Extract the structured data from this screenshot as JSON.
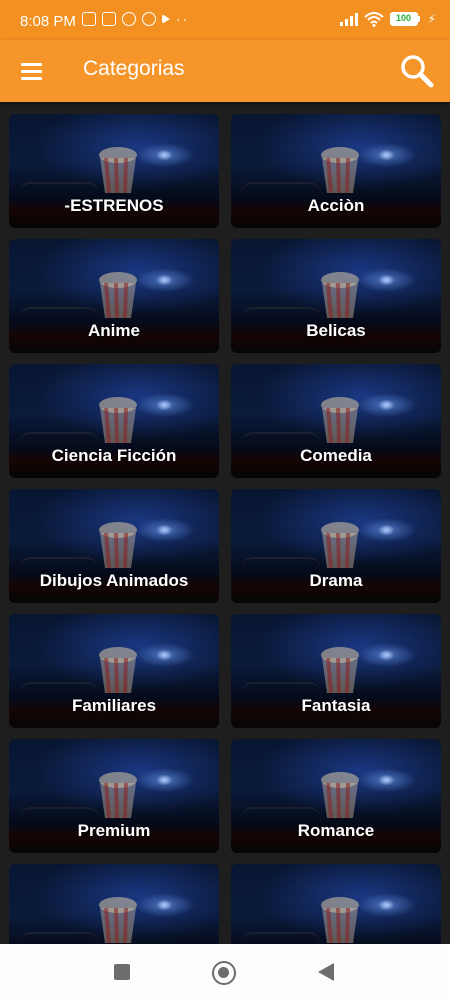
{
  "status_bar": {
    "time": "8:08 PM",
    "battery": "100",
    "notification_icons": [
      "sync-off-icon",
      "app-icon",
      "chat-icon",
      "app-icon",
      "play-icon",
      "more-dots-icon"
    ]
  },
  "app_bar": {
    "title": "Categorias",
    "color": "#f5952a"
  },
  "categories": [
    {
      "label": "-ESTRENOS"
    },
    {
      "label": "Acciòn"
    },
    {
      "label": "Anime"
    },
    {
      "label": "Belicas"
    },
    {
      "label": "Ciencia Ficción"
    },
    {
      "label": "Comedia"
    },
    {
      "label": "Dibujos Animados"
    },
    {
      "label": "Drama"
    },
    {
      "label": "Familiares"
    },
    {
      "label": "Fantasia"
    },
    {
      "label": "Premium"
    },
    {
      "label": "Romance"
    },
    {
      "label": ""
    },
    {
      "label": ""
    }
  ],
  "nav_bar": {
    "buttons": [
      "recents-button",
      "home-button",
      "back-button"
    ]
  }
}
